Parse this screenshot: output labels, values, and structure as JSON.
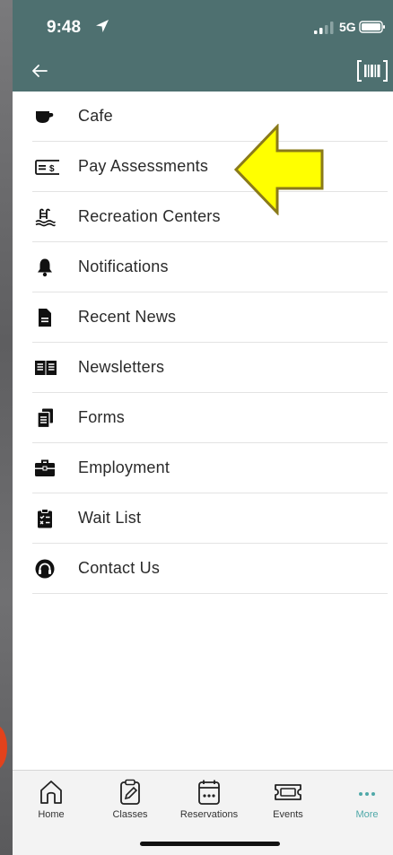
{
  "status_bar": {
    "time": "9:48",
    "network": "5G"
  },
  "colors": {
    "header": "#4e7070",
    "accent": "#4fa8a8",
    "highlight_arrow": "#ffff00"
  },
  "menu": {
    "items": [
      {
        "label": "Cafe",
        "icon": "coffee-cup-icon"
      },
      {
        "label": "Pay Assessments",
        "icon": "bill-dollar-icon"
      },
      {
        "label": "Recreation Centers",
        "icon": "pool-ladder-icon"
      },
      {
        "label": "Notifications",
        "icon": "bell-icon"
      },
      {
        "label": "Recent News",
        "icon": "document-icon"
      },
      {
        "label": "Newsletters",
        "icon": "open-book-icon"
      },
      {
        "label": "Forms",
        "icon": "stacked-documents-icon"
      },
      {
        "label": "Employment",
        "icon": "briefcase-icon"
      },
      {
        "label": "Wait List",
        "icon": "clipboard-list-icon"
      },
      {
        "label": "Contact Us",
        "icon": "headset-icon"
      }
    ]
  },
  "tabs": [
    {
      "label": "Home",
      "icon": "home-icon"
    },
    {
      "label": "Classes",
      "icon": "clipboard-pen-icon"
    },
    {
      "label": "Reservations",
      "icon": "calendar-icon"
    },
    {
      "label": "Events",
      "icon": "ticket-icon"
    },
    {
      "label": "More",
      "icon": "more-dots-icon",
      "active": true
    }
  ]
}
